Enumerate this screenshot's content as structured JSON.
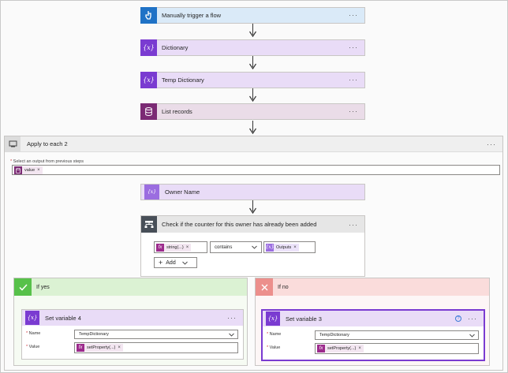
{
  "colors": {
    "trigger": "#1f72c6",
    "variable": "#7a3bd1",
    "dataverse": "#7b2a74",
    "condition": "#484f58",
    "yes": "#57c14a",
    "no": "#ec8f8c"
  },
  "steps": [
    {
      "title": "Manually trigger a flow",
      "icon": "hand-touch-icon"
    },
    {
      "title": "Dictionary",
      "icon": "variable-icon"
    },
    {
      "title": "Temp Dictionary",
      "icon": "variable-icon"
    },
    {
      "title": "List records",
      "icon": "database-icon"
    }
  ],
  "menu_glyph": "···",
  "apply_each": {
    "title": "Apply to each 2",
    "select_label": "Select an output from previous steps",
    "required_mark": "*",
    "token": "value"
  },
  "owner": {
    "title": "Owner Name"
  },
  "condition": {
    "title": "Check if the counter for this owner has already been added",
    "left_token": "string(...)",
    "operator": "contains",
    "right_token": "Outputs",
    "add_label": "Add"
  },
  "branches": {
    "yes": {
      "title": "If yes",
      "action": {
        "title": "Set variable 4",
        "name_label": "Name",
        "name_value": "TempDictionary",
        "value_label": "Value",
        "value_token": "setProperty(...)"
      }
    },
    "no": {
      "title": "If no",
      "action": {
        "title": "Set variable 3",
        "name_label": "Name",
        "name_value": "TempDictionary",
        "value_label": "Value",
        "value_token": "setProperty(...)"
      }
    }
  }
}
